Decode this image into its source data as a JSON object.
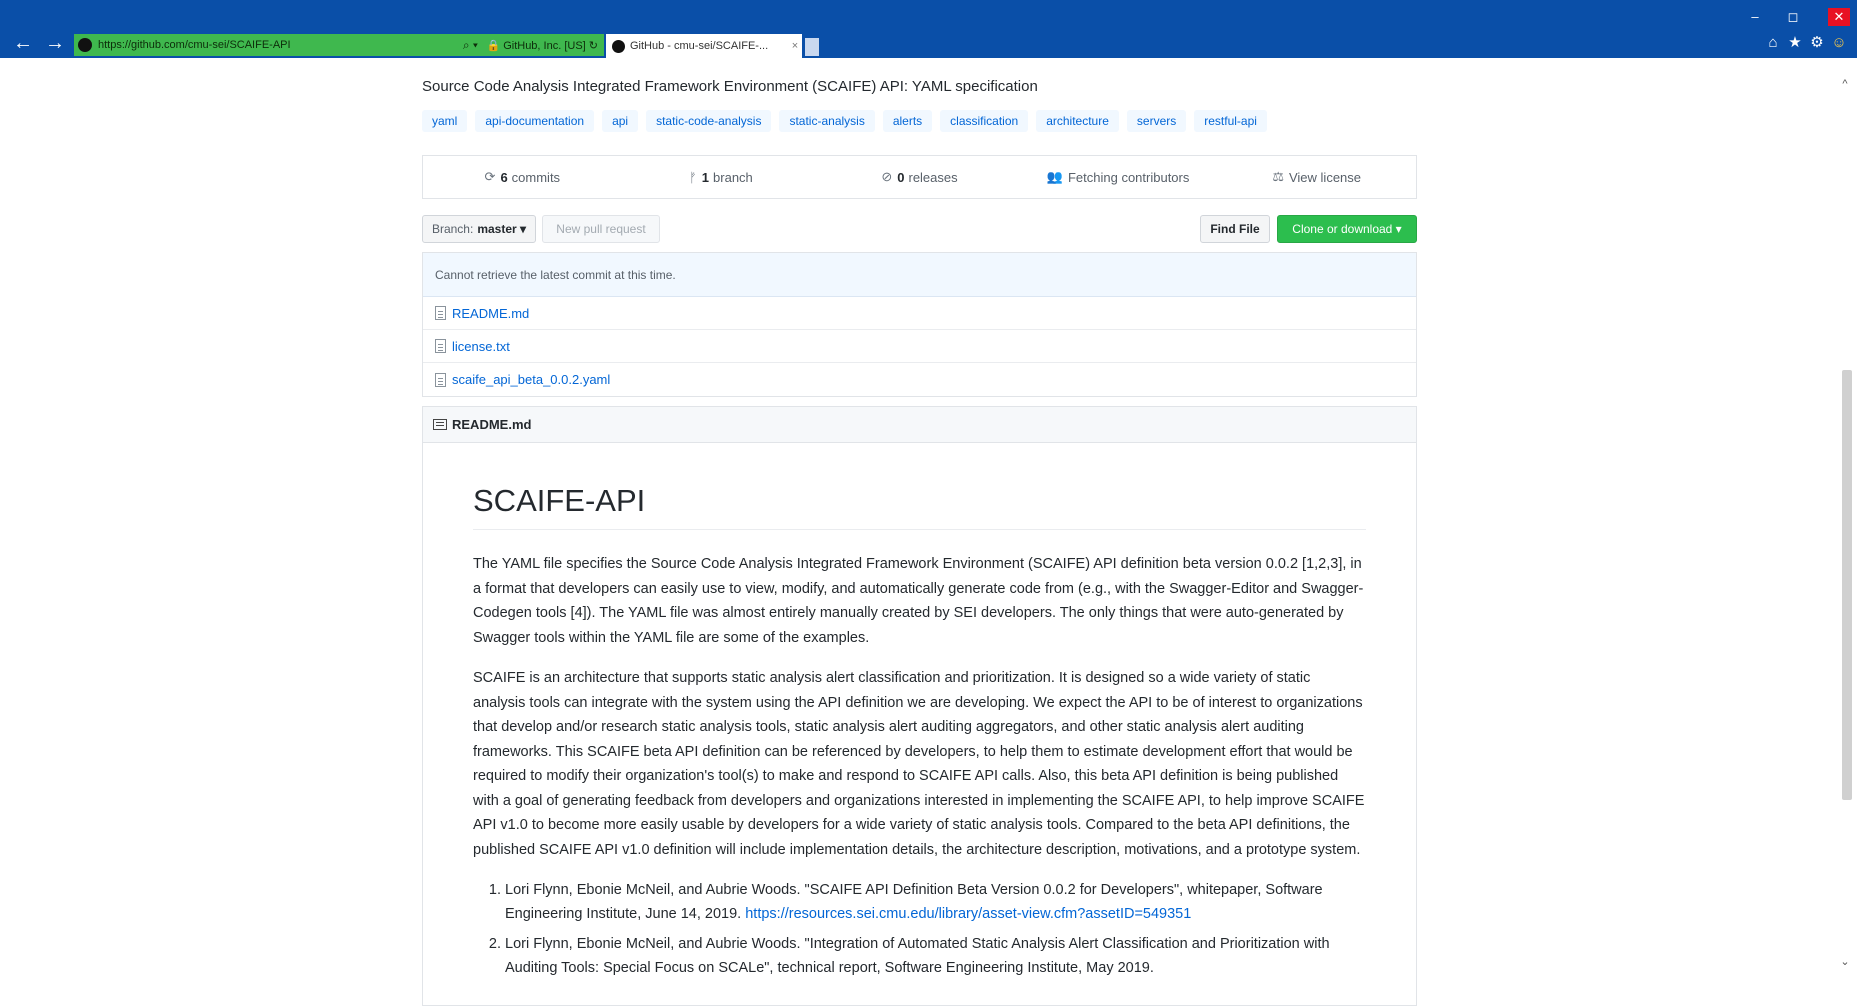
{
  "browser": {
    "address_url": "https://github.com/cmu-sei/SCAIFE-API",
    "search_glyph": "⌕ ▾",
    "cert_label": "🔒 GitHub, Inc. [US] ↻",
    "tab_title": "GitHub - cmu-sei/SCAIFE-...",
    "tab_close": "×",
    "back_glyph": "←",
    "forward_glyph": "→",
    "win_minimize": "–",
    "win_maximize": "◻",
    "win_close": "✕",
    "home_glyph": "⌂",
    "star_glyph": "★",
    "gear_glyph": "⚙",
    "smiley_glyph": "☺"
  },
  "repo": {
    "description": "Source Code Analysis Integrated Framework Environment (SCAIFE) API: YAML specification",
    "topics": [
      "yaml",
      "api-documentation",
      "api",
      "static-code-analysis",
      "static-analysis",
      "alerts",
      "classification",
      "architecture",
      "servers",
      "restful-api"
    ],
    "summary": {
      "commits_count": "6",
      "commits_label": "commits",
      "branch_count": "1",
      "branch_label": "branch",
      "releases_count": "0",
      "releases_label": "releases",
      "contributors_label": "Fetching contributors",
      "license_label": "View license"
    },
    "toolbar": {
      "branch_prefix": "Branch:",
      "branch_name": "master ▾",
      "new_pr_label": "New pull request",
      "find_file_label": "Find File",
      "clone_label": "Clone or download ▾"
    },
    "commit_message": "Cannot retrieve the latest commit at this time.",
    "files": [
      "README.md",
      "license.txt",
      "scaife_api_beta_0.0.2.yaml"
    ]
  },
  "readme": {
    "header": "README.md",
    "title": "SCAIFE-API",
    "p1": "The YAML file specifies the Source Code Analysis Integrated Framework Environment (SCAIFE) API definition beta version 0.0.2 [1,2,3], in a format that developers can easily use to view, modify, and automatically generate code from (e.g., with the Swagger-Editor and Swagger-Codegen tools [4]). The YAML file was almost entirely manually created by SEI developers. The only things that were auto-generated by Swagger tools within the YAML file are some of the examples.",
    "p2": "SCAIFE is an architecture that supports static analysis alert classification and prioritization. It is designed so a wide variety of static analysis tools can integrate with the system using the API definition we are developing. We expect the API to be of interest to organizations that develop and/or research static analysis tools, static analysis alert auditing aggregators, and other static analysis alert auditing frameworks. This SCAIFE beta API definition can be referenced by developers, to help them to estimate development effort that would be required to modify their organization's tool(s) to make and respond to SCAIFE API calls. Also, this beta API definition is being published with a goal of generating feedback from developers and organizations interested in implementing the SCAIFE API, to help improve SCAIFE API v1.0 to become more easily usable by developers for a wide variety of static analysis tools. Compared to the beta API definitions, the published SCAIFE API v1.0 definition will include implementation details, the architecture description, motivations, and a prototype system.",
    "ref1_text": "Lori Flynn, Ebonie McNeil, and Aubrie Woods. \"SCAIFE API Definition Beta Version 0.0.2 for Developers\", whitepaper, Software Engineering Institute, June 14, 2019.",
    "ref1_link": "https://resources.sei.cmu.edu/library/asset-view.cfm?assetID=549351",
    "ref2_text": "Lori Flynn, Ebonie McNeil, and Aubrie Woods. \"Integration of Automated Static Analysis Alert Classification and Prioritization with Auditing Tools: Special Focus on SCALe\", technical report, Software Engineering Institute, May 2019."
  },
  "scrollbar": {
    "up_glyph": "^",
    "down_glyph": "⌄"
  }
}
